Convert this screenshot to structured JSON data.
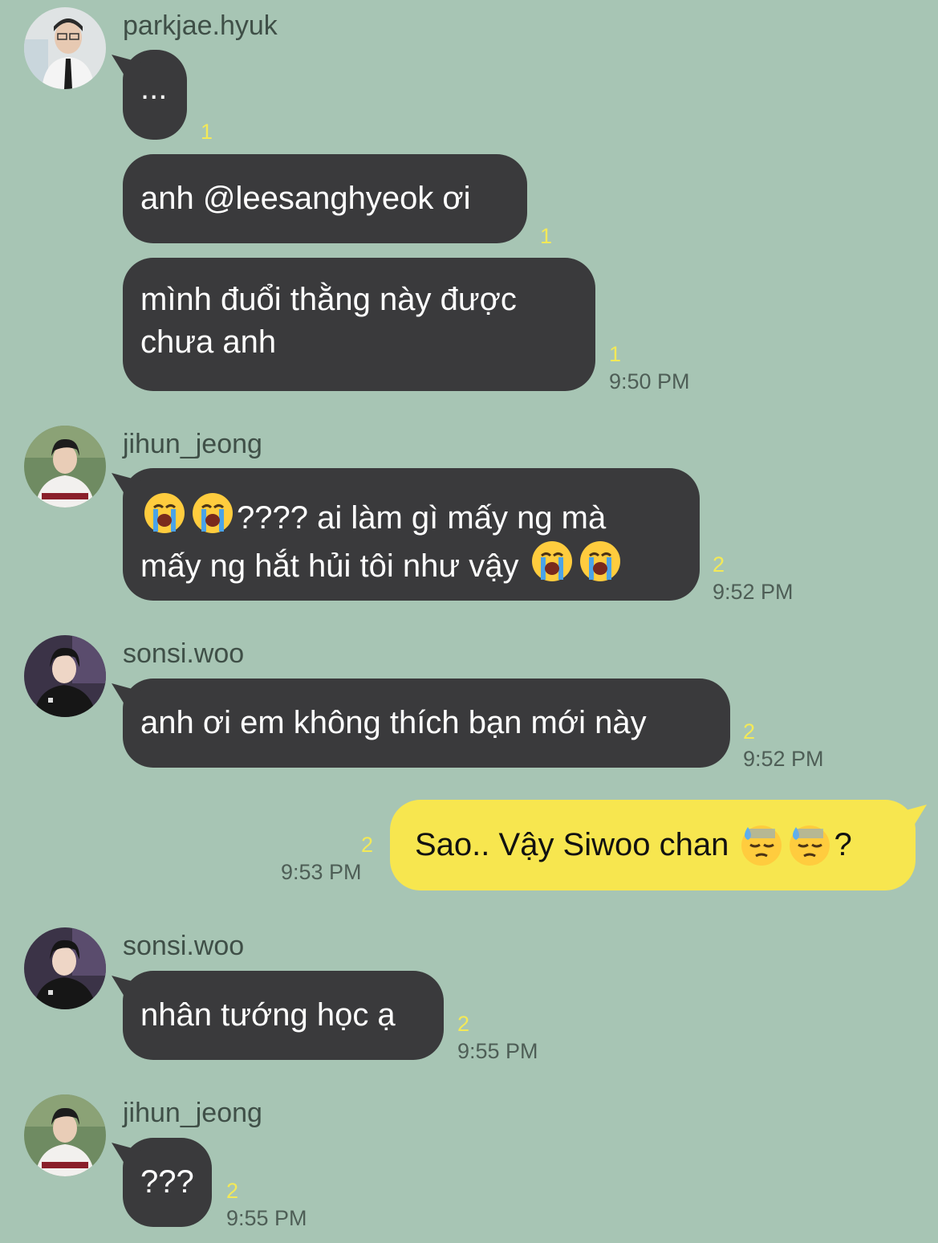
{
  "messages": [
    {
      "sender": "parkjae.hyuk",
      "text": "...",
      "count": "1"
    },
    {
      "text": "anh @leesanghyeok ơi",
      "count": "1"
    },
    {
      "text_l1": "mình đuổi thằng này được",
      "text_l2": "chưa anh",
      "count": "1",
      "time": "9:50 PM"
    },
    {
      "sender": "jihun_jeong",
      "text_l1a": "????",
      "text_l1b": " ai làm gì mấy ng mà",
      "text_l2": "mấy ng hắt hủi tôi như vậy",
      "count": "2",
      "time": "9:52 PM"
    },
    {
      "sender": "sonsi.woo",
      "text": "anh ơi em không thích bạn mới này",
      "count": "2",
      "time": "9:52 PM"
    },
    {
      "text_a": "Sao.. Vậy Siwoo chan ",
      "text_b": "?",
      "count": "2",
      "time": "9:53 PM"
    },
    {
      "sender": "sonsi.woo",
      "text": "nhân tướng học ạ",
      "count": "2",
      "time": "9:55 PM"
    },
    {
      "sender": "jihun_jeong",
      "text": "???",
      "count": "2",
      "time": "9:55 PM"
    }
  ],
  "icons": {
    "crying": "loudly-crying-face-emoji",
    "sweat": "downcast-face-with-sweat-emoji"
  },
  "colors": {
    "background": "#a7c5b4",
    "received_bubble": "#3a3a3c",
    "sent_bubble": "#f7e64f",
    "unread_count": "#f3e957"
  }
}
